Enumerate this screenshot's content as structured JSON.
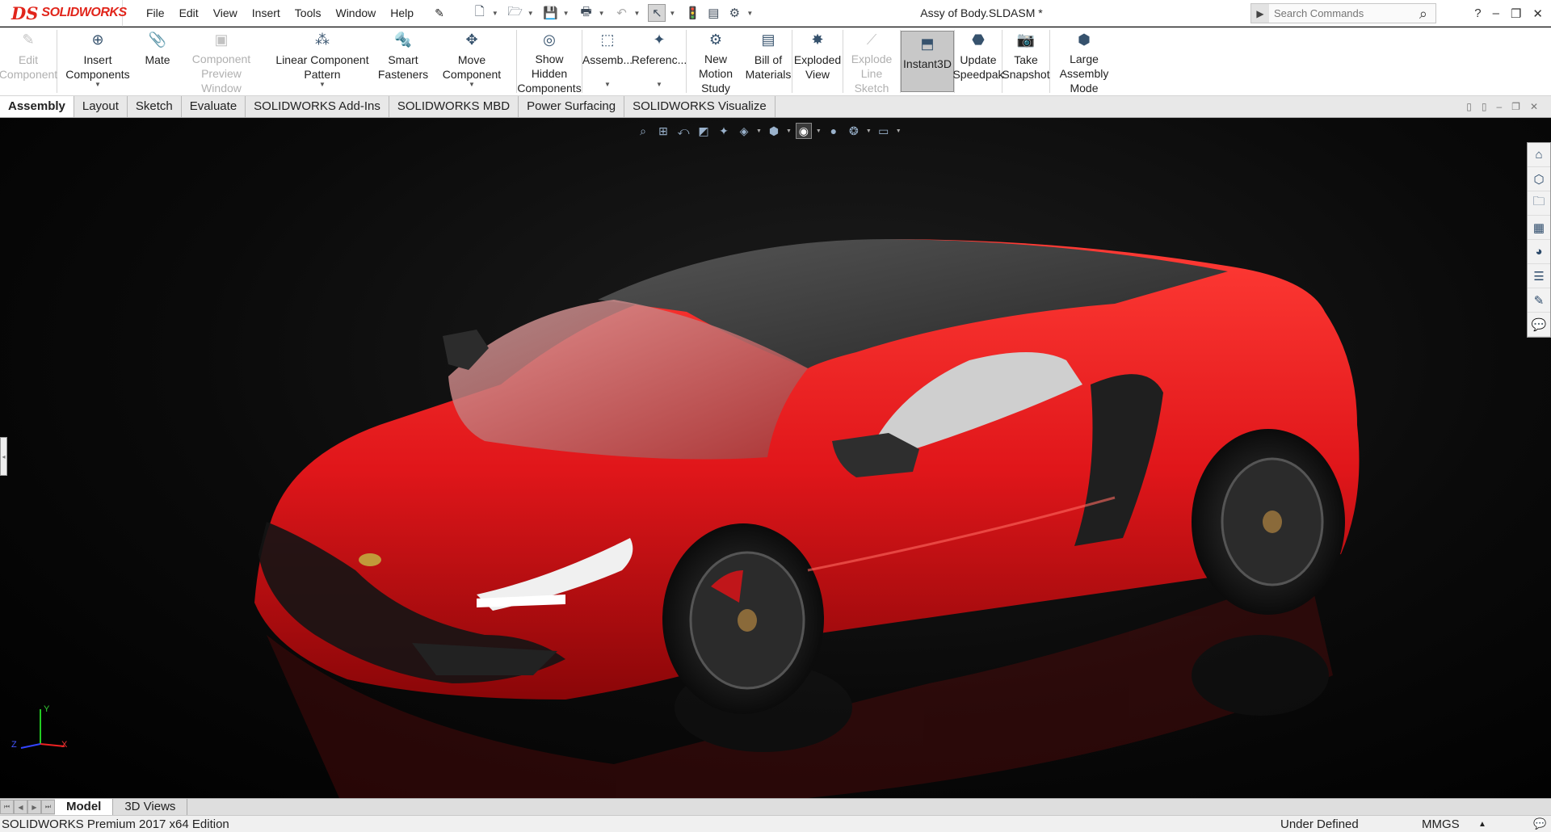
{
  "app": {
    "logo_mark": "DS",
    "logo_text": "SOLIDWORKS",
    "doc_title": "Assy of Body.SLDASM *"
  },
  "menu": [
    "File",
    "Edit",
    "View",
    "Insert",
    "Tools",
    "Window",
    "Help"
  ],
  "search": {
    "placeholder": "Search Commands"
  },
  "ribbon": [
    {
      "label1": "Edit",
      "label2": "Component",
      "disabled": true,
      "icon": "edit-component-icon"
    },
    {
      "label1": "Insert Components",
      "label2": "",
      "icon": "insert-components-icon",
      "dropdown": true
    },
    {
      "label1": "Mate",
      "label2": "",
      "icon": "mate-icon"
    },
    {
      "label1": "Component",
      "label2": "Preview Window",
      "disabled": true,
      "icon": "preview-window-icon"
    },
    {
      "label1": "Linear Component Pattern",
      "label2": "",
      "icon": "linear-pattern-icon",
      "dropdown": true
    },
    {
      "label1": "Smart",
      "label2": "Fasteners",
      "icon": "smart-fasteners-icon"
    },
    {
      "label1": "Move Component",
      "label2": "",
      "icon": "move-component-icon",
      "dropdown": true
    },
    {
      "label1": "Show Hidden",
      "label2": "Components",
      "icon": "show-hidden-icon"
    },
    {
      "label1": "Assemb...",
      "label2": "",
      "icon": "assembly-features-icon",
      "dropdown": true
    },
    {
      "label1": "Referenc...",
      "label2": "",
      "icon": "reference-geometry-icon",
      "dropdown": true
    },
    {
      "label1": "New Motion",
      "label2": "Study",
      "icon": "motion-study-icon"
    },
    {
      "label1": "Bill of",
      "label2": "Materials",
      "icon": "bom-icon"
    },
    {
      "label1": "Exploded",
      "label2": "View",
      "icon": "exploded-view-icon"
    },
    {
      "label1": "Explode",
      "label2": "Line Sketch",
      "disabled": true,
      "icon": "explode-line-icon"
    },
    {
      "label1": "Instant3D",
      "label2": "",
      "active": true,
      "icon": "instant3d-icon"
    },
    {
      "label1": "Update",
      "label2": "Speedpak",
      "icon": "speedpak-icon"
    },
    {
      "label1": "Take",
      "label2": "Snapshot",
      "icon": "snapshot-icon"
    },
    {
      "label1": "Large Assembly",
      "label2": "Mode",
      "icon": "large-assembly-icon"
    }
  ],
  "tabs": [
    "Assembly",
    "Layout",
    "Sketch",
    "Evaluate",
    "SOLIDWORKS Add-Ins",
    "SOLIDWORKS MBD",
    "Power Surfacing",
    "SOLIDWORKS Visualize"
  ],
  "bottom_tabs": [
    "Model",
    "3D Views"
  ],
  "status": {
    "edition": "SOLIDWORKS Premium 2017 x64 Edition",
    "state": "Under Defined",
    "units": "MMGS"
  },
  "triad": {
    "x": "X",
    "y": "Y",
    "z": "Z"
  },
  "colors": {
    "accent": "#e1251b",
    "car_body": "#e0161a",
    "carbon": "#2a2a2a"
  }
}
